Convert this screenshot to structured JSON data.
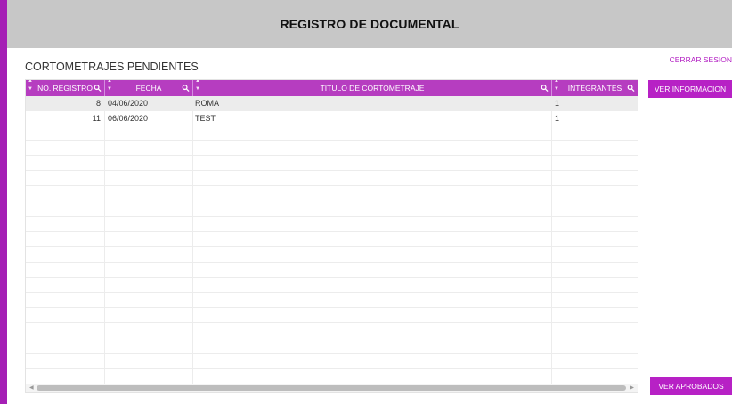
{
  "header": {
    "title": "REGISTRO DE DOCUMENTAL"
  },
  "section": {
    "title": "CORTOMETRAJES PENDIENTES"
  },
  "logout_label": "CERRAR SESION",
  "buttons": {
    "view_info": "VER INFORMACION",
    "view_approved": "VER APROBADOS"
  },
  "table": {
    "columns": [
      "NO. REGISTRO",
      "FECHA",
      "TITULO DE CORTOMETRAJE",
      "INTEGRANTES"
    ],
    "rows": [
      {
        "registro": "8",
        "fecha": "04/06/2020",
        "titulo": "ROMA",
        "integrantes": "1"
      },
      {
        "registro": "11",
        "fecha": "06/06/2020",
        "titulo": "TEST",
        "integrantes": "1"
      }
    ],
    "selected_row": 0
  },
  "colors": {
    "accent": "#b721c5",
    "header_bg": "#c7c7c7",
    "table_header": "#b63dc0",
    "left_bar": "#a51fb5"
  },
  "icons": {
    "sort": "sort-arrows-icon",
    "filter": "search-icon"
  }
}
